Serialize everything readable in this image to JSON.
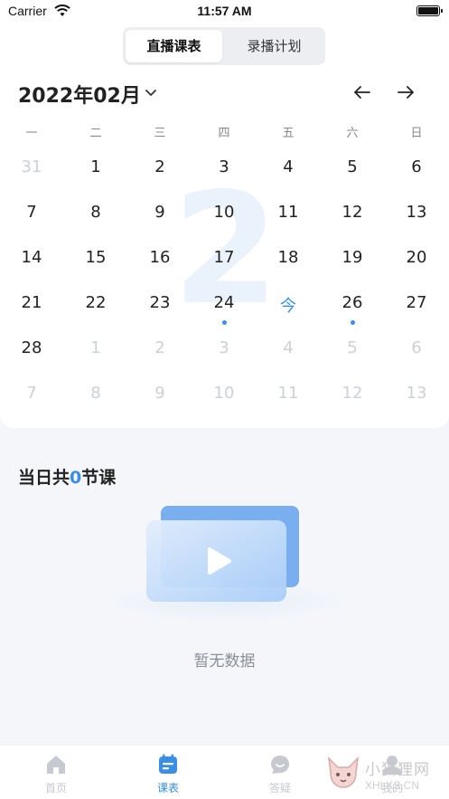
{
  "status_bar": {
    "carrier": "Carrier",
    "time": "11:57 AM"
  },
  "segmented": {
    "tabs": [
      "直播课表",
      "录播计划"
    ],
    "active_index": 0
  },
  "calendar": {
    "month_label": "2022年02月",
    "big_month_number": "2",
    "weekdays": [
      "一",
      "二",
      "三",
      "四",
      "五",
      "六",
      "日"
    ],
    "weeks": [
      [
        "31",
        "1",
        "2",
        "3",
        "4",
        "5",
        "6"
      ],
      [
        "7",
        "8",
        "9",
        "10",
        "11",
        "12",
        "13"
      ],
      [
        "14",
        "15",
        "16",
        "17",
        "18",
        "19",
        "20"
      ],
      [
        "21",
        "22",
        "23",
        "24",
        "今",
        "26",
        "27"
      ],
      [
        "28",
        "1",
        "2",
        "3",
        "4",
        "5",
        "6"
      ],
      [
        "7",
        "8",
        "9",
        "10",
        "11",
        "12",
        "13"
      ]
    ],
    "today_label": "今",
    "muted_days": [
      "0-0",
      "4-1",
      "4-2",
      "4-3",
      "4-4",
      "4-5",
      "4-6",
      "5-0",
      "5-1",
      "5-2",
      "5-3",
      "5-4",
      "5-5",
      "5-6"
    ],
    "days_with_classes": [
      "3-3",
      "3-5"
    ]
  },
  "summary": {
    "prefix": "当日共",
    "count": "0",
    "suffix": "节课"
  },
  "empty_state": {
    "text": "暂无数据",
    "icon": "video-play-icon"
  },
  "tabbar": {
    "items": [
      {
        "label": "首页",
        "icon": "home-icon"
      },
      {
        "label": "课表",
        "icon": "calendar-icon"
      },
      {
        "label": "答疑",
        "icon": "chat-bubble-icon"
      },
      {
        "label": "我的",
        "icon": "person-icon"
      }
    ],
    "active_index": 1
  },
  "watermark": {
    "text": "小狐狸网",
    "sub": "XHLKS.CN"
  },
  "colors": {
    "accent": "#3a8ee6",
    "muted": "#ccd0d8",
    "background": "#f4f6fa"
  }
}
